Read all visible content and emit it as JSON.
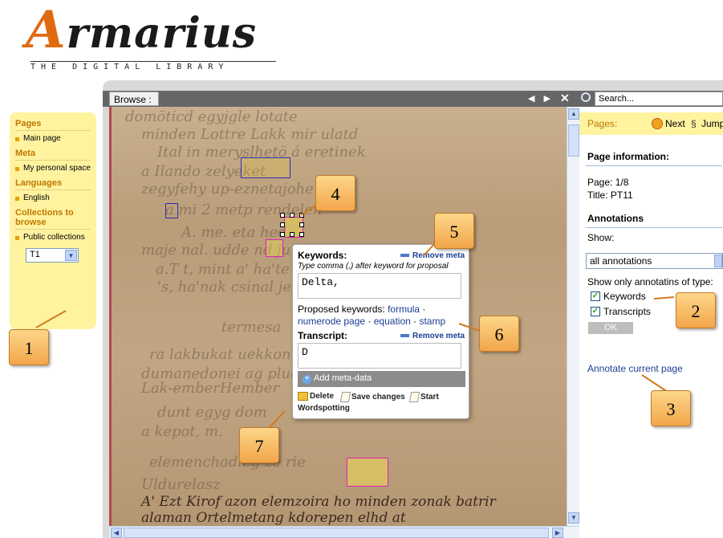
{
  "logo": {
    "title": "Armarius",
    "subtitle": "THE DIGITAL LIBRARY"
  },
  "leftnav": {
    "sections": [
      {
        "heading": "Pages",
        "items": [
          "Main page"
        ]
      },
      {
        "heading": "Meta",
        "items": [
          "My personal space"
        ]
      },
      {
        "heading": "Languages",
        "items": [
          "English"
        ]
      },
      {
        "heading": "Collections to browse",
        "items": [
          "Public collections"
        ]
      }
    ],
    "collection_select": "T1"
  },
  "toolbar": {
    "tab": "Browse :",
    "arrows": "◀ ▶",
    "close": "✕",
    "search_placeholder": "Search..."
  },
  "right_panel": {
    "pages_label": "Pages:",
    "next_label": "Next",
    "jump_label": "Jump",
    "page_info_heading": "Page information:",
    "page": "Page: 1/8",
    "title": "Title: PT11",
    "annotations_heading": "Annotations",
    "show_label": "Show:",
    "show_select": "all annotations",
    "type_filter_label": "Show only annotatins of type:",
    "types": [
      {
        "label": "Keywords",
        "checked": true
      },
      {
        "label": "Transcripts",
        "checked": true
      }
    ],
    "ok_label": "OK",
    "annotate_link": "Annotate current page"
  },
  "popup": {
    "keywords_label": "Keywords:",
    "remove_meta": "Remove meta",
    "hint": "Type comma (,) after keyword for proposal",
    "keywords_value": "Delta,",
    "proposed_label": "Proposed keywords:",
    "proposed": [
      "formula",
      "numerode page",
      "equation",
      "stamp"
    ],
    "transcript_label": "Transcript:",
    "transcript_value": "D",
    "add_meta": "Add meta-data",
    "delete_label": "Delete",
    "save_label": "Save changes",
    "start_label": "Start",
    "wordspotting_label": "Wordspotting"
  },
  "callouts": [
    "1",
    "2",
    "3",
    "4",
    "5",
    "6",
    "7"
  ],
  "manuscript_lines": [
    "domöticd egyjgle lotate",
    "minden Lottre Lakk mir ulatd",
    "Ital in meryslhetö á eretinek",
    "a Ilando zelyeket",
    "zegyfehy up-eznetajohe",
    "a mi 2 metp rendelen",
    "A. me. eta hed. ..",
    "maje nal. udde nd ju",
    "a.T t, mint a' ha'te",
    "'s, ha'nak csinal jel",
    "termesa",
    "ra lakbukat uekkon",
    "dumanedonei ag pluelt",
    "Lak-emberHember",
    "a kepot, m.",
    "dunt egyg dom",
    "elemenchadleg ze rie",
    "Uldurelasz",
    "A' Ezt Kirof azon elemzoira ho minden zonak batrir",
    "alaman Ortelmetang kdorepen elhd at"
  ],
  "colors": {
    "nav_bg": "#fff3a0",
    "nav_heading": "#c07800",
    "link": "#1b3f94",
    "callout": "#f2a64a",
    "keyword_box": "#e020c0",
    "transcript_box": "#2a30b0"
  }
}
